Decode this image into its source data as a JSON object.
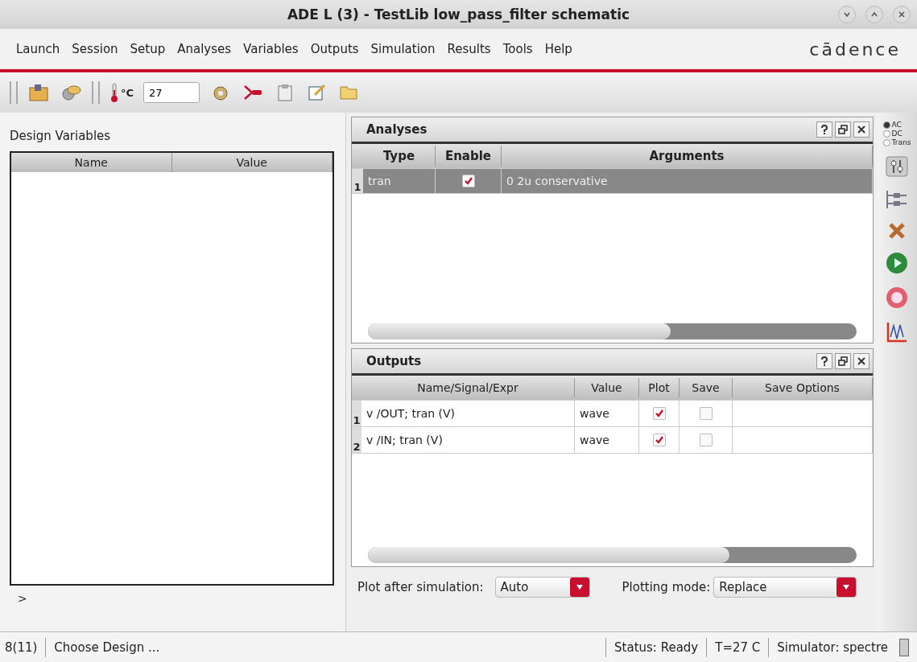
{
  "window": {
    "title": "ADE L (3) - TestLib low_pass_filter schematic"
  },
  "menu": [
    "Launch",
    "Session",
    "Setup",
    "Analyses",
    "Variables",
    "Outputs",
    "Simulation",
    "Results",
    "Tools",
    "Help"
  ],
  "logo": "cādence",
  "toolbar": {
    "temperature_unit": "°C",
    "temperature": "27"
  },
  "design_variables": {
    "title": "Design Variables",
    "columns": [
      "Name",
      "Value"
    ],
    "expander": ">"
  },
  "analyses": {
    "title": "Analyses",
    "columns": [
      "Type",
      "Enable",
      "Arguments"
    ],
    "rows": [
      {
        "index": "1",
        "type": "tran",
        "enabled": true,
        "arguments": "0 2u conservative",
        "selected": true
      }
    ]
  },
  "outputs": {
    "title": "Outputs",
    "columns": [
      "Name/Signal/Expr",
      "Value",
      "Plot",
      "Save",
      "Save Options"
    ],
    "rows": [
      {
        "index": "1",
        "name": "v /OUT; tran (V)",
        "value": "wave",
        "plot": true,
        "save": false
      },
      {
        "index": "2",
        "name": "v /IN; tran (V)",
        "value": "wave",
        "plot": true,
        "save": false
      }
    ]
  },
  "plot_after_simulation": {
    "label": "Plot after simulation:",
    "value": "Auto"
  },
  "plotting_mode": {
    "label": "Plotting mode:",
    "value": "Replace"
  },
  "analysis_types": [
    {
      "label": "AC",
      "selected": true
    },
    {
      "label": "DC",
      "selected": false
    },
    {
      "label": "Trans",
      "selected": false
    }
  ],
  "status_bar": {
    "count": "8(11)",
    "message": "Choose Design ...",
    "status": "Status: Ready",
    "temperature": "T=27 C",
    "simulator": "Simulator: spectre"
  }
}
